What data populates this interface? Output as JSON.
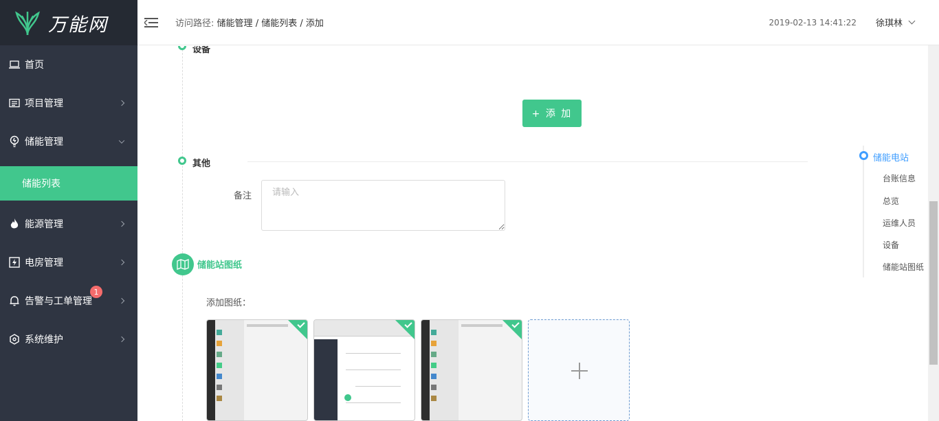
{
  "brand": {
    "name": "万能网",
    "logo_icon": "leaf-logo-icon",
    "accent": "#41c78d"
  },
  "sidebar": {
    "items": [
      {
        "label": "首页",
        "icon": "laptop-icon"
      },
      {
        "label": "项目管理",
        "icon": "list-card-icon"
      },
      {
        "label": "储能管理",
        "icon": "bulb-icon",
        "expanded": true
      },
      {
        "label": "储能列表",
        "sub": true,
        "active": true
      },
      {
        "label": "能源管理",
        "icon": "flame-icon"
      },
      {
        "label": "电房管理",
        "icon": "bolt-box-icon"
      },
      {
        "label": "告警与工单管理",
        "icon": "bell-icon",
        "badge": "1"
      },
      {
        "label": "系统维护",
        "icon": "gear-icon"
      }
    ]
  },
  "header": {
    "breadcrumb_prefix": "访问路径:",
    "breadcrumb_1": "储能管理",
    "breadcrumb_2": "储能列表",
    "breadcrumb_3": "添加",
    "sep": "/",
    "datetime": "2019-02-13 14:41:22",
    "user": "徐琪林"
  },
  "main": {
    "section_equipment": "设备",
    "add_button": "+ 添 加",
    "section_other": "其他",
    "note_label": "备注",
    "note_placeholder": "请输入",
    "section_drawings": "储能站图纸",
    "drawings_label": "添加图纸："
  },
  "anchor_nav": {
    "items": [
      "储能电站",
      "台账信息",
      "总览",
      "运维人员",
      "设备",
      "储能站图纸"
    ],
    "active_color": "#409eff"
  }
}
